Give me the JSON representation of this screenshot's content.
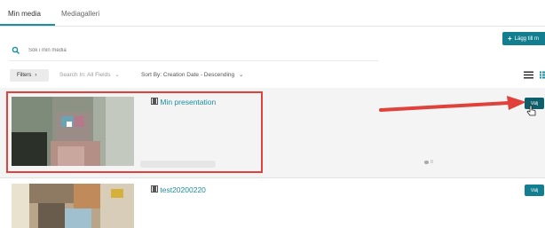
{
  "tabs": [
    {
      "label": "Min media",
      "active": true
    },
    {
      "label": "Mediagalleri",
      "active": false
    }
  ],
  "add_button": {
    "label": "Lägg till m"
  },
  "search": {
    "placeholder": "Sök i min media",
    "value": ""
  },
  "filters": {
    "filters_label": "Filters",
    "search_in": "Search In: All Fields",
    "sort_by": "Sort By: Creation Date - Descending"
  },
  "entries": [
    {
      "title": "Min presentation",
      "comments": "0",
      "action_label": "Välj",
      "selected": true
    },
    {
      "title": "test20200220",
      "action_label": "Välj",
      "selected": false
    }
  ],
  "colors": {
    "accent": "#127e8f",
    "link": "#1b8ea1",
    "highlight": "#e0413a"
  }
}
